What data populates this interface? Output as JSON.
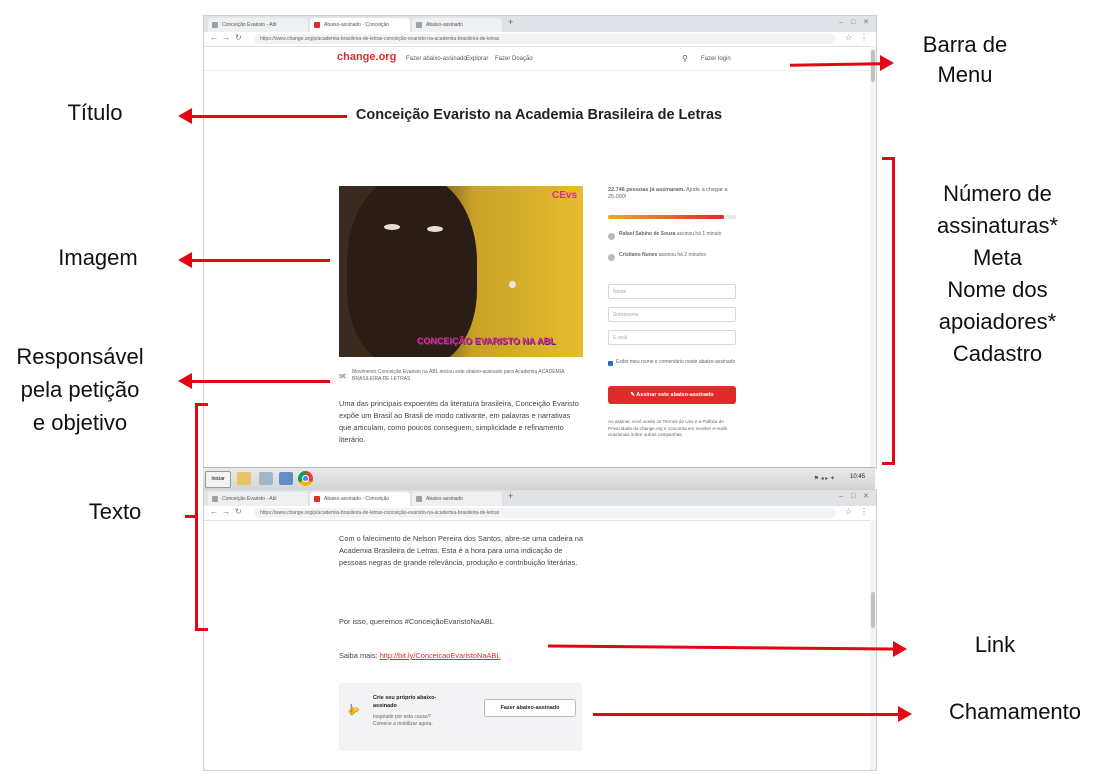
{
  "browser": {
    "tabs": [
      "Conceição Evaristo - Abl",
      "Abaixo-assinado - Conceição",
      "Abaixo-assinado"
    ],
    "url": "https://www.change.org/p/academia-brasileira-de-letras-conceição-evaristo-na-academia-brasileira-de-letras"
  },
  "site": {
    "logo": "change.org",
    "nav": [
      "Fazer abaixo-assinado",
      "Explorar",
      "Fazer Doação"
    ],
    "login": "Fazer login"
  },
  "petition": {
    "title": "Conceição Evaristo na Academia Brasileira de Letras",
    "image_caption": "CONCEIÇÃO EVARISTO NA ABL",
    "image_badge": "CEvs",
    "author_line": "Movimento Conceição Evaristo na ABL iniciou este abaixo-assinado para Academia ACADEMIA BRASILEIRA DE LETRAS",
    "paragraph1": "Uma das principais expoentes da literatura brasileira, Conceição Evaristo expõe um Brasil ao Brasil de modo cativante, em palavras e narrativas que articulam, como poucos conseguem, simplicidade e refinamento literário.",
    "paragraph2": "Com o falecimento de Nelson Pereira dos Santos, abre-se uma cadeira na Academia Brasileira de Letras. Esta é a hora para uma indicação de pessoas negras de grande relevância, produção e contribuição literárias.",
    "paragraph3": "Por isso, queremos #ConceiçãoEvaristoNaABL",
    "more_label": "Saiba mais:",
    "more_link": "http://bit.ly/ConceicaoEvaristoNaABL",
    "signatures": "22.746 pessoas já assinaram.",
    "signatures_goal": "Ajude a chegar a 25.000!",
    "progress": 0.91,
    "supporters": [
      {
        "name": "Rafael Sabino de Souza",
        "note": "assinou há 1 minuto"
      },
      {
        "name": "Cristiano Nunes",
        "note": "assinou há 2 minutos"
      }
    ],
    "fields": [
      "Nome",
      "Sobrenome",
      "E-mail"
    ],
    "checkbox_label": "Exibir meu nome e comentário neste abaixo-assinado",
    "sign_button": "Assinar este abaixo-assinado",
    "terms_text": "Ao assinar, você aceita os Termos de Uso e a Política de Privacidade da change.org e concorda em receber e-mails ocasionais sobre outras campanhas.",
    "callout_title": "Crie seu próprio abaixo-assinado",
    "callout_sub": "Inspirado por esta causa? Comece a mobilizar agora.",
    "callout_button": "Fazer abaixo-assinado"
  },
  "taskbar": {
    "start": "Iniciar",
    "clock": "10:45"
  },
  "annotations": {
    "menu": [
      "Barra de",
      "Menu"
    ],
    "title": "Título",
    "image": "Imagem",
    "responsible": [
      "Responsável",
      "pela petição",
      "e objetivo"
    ],
    "text": "Texto",
    "signatures": [
      "Número de",
      "assinaturas*",
      "Meta",
      "Nome dos",
      "apoiadores*",
      "Cadastro"
    ],
    "link": "Link",
    "call": "Chamamento"
  },
  "colors": {
    "accent": "#e02b2b",
    "annotation": "#e30613"
  }
}
